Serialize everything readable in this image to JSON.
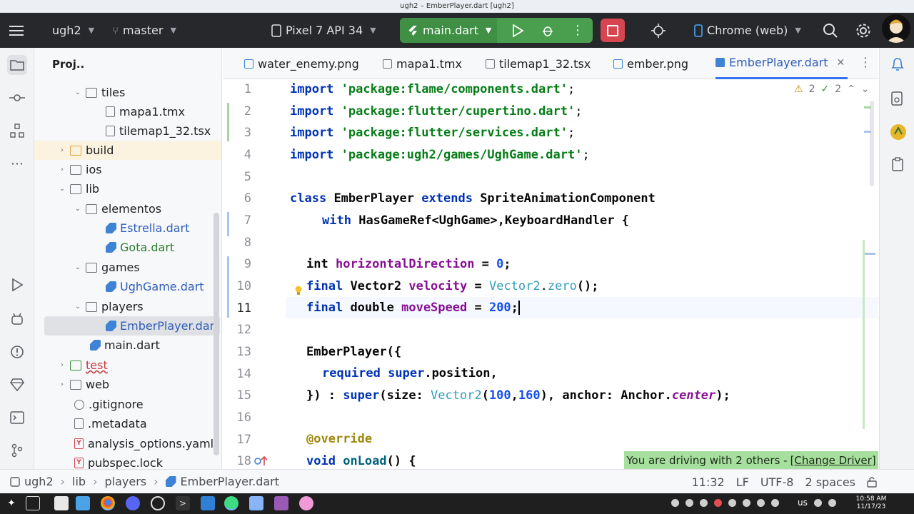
{
  "window_title": "ugh2 – EmberPlayer.dart [ugh2]",
  "toolbar": {
    "project": "ugh2",
    "branch": "master",
    "device": "Pixel 7 API 34",
    "run_config": "main.dart",
    "target": "Chrome (web)"
  },
  "project_panel": {
    "title": "Proj..",
    "items": [
      {
        "label": "tiles",
        "type": "folder"
      },
      {
        "label": "mapa1.tmx",
        "type": "file"
      },
      {
        "label": "tilemap1_32.tsx",
        "type": "file"
      },
      {
        "label": "build",
        "type": "folder"
      },
      {
        "label": "ios",
        "type": "folder"
      },
      {
        "label": "lib",
        "type": "folder"
      },
      {
        "label": "elementos",
        "type": "folder"
      },
      {
        "label": "Estrella.dart",
        "type": "dart"
      },
      {
        "label": "Gota.dart",
        "type": "dart"
      },
      {
        "label": "games",
        "type": "folder"
      },
      {
        "label": "UghGame.dart",
        "type": "dart"
      },
      {
        "label": "players",
        "type": "folder"
      },
      {
        "label": "EmberPlayer.dart",
        "type": "dart"
      },
      {
        "label": "main.dart",
        "type": "dart"
      },
      {
        "label": "test",
        "type": "folder"
      },
      {
        "label": "web",
        "type": "folder"
      },
      {
        "label": ".gitignore",
        "type": "file"
      },
      {
        "label": ".metadata",
        "type": "file"
      },
      {
        "label": "analysis_options.yaml",
        "type": "yaml"
      },
      {
        "label": "pubspec.lock",
        "type": "yaml"
      }
    ]
  },
  "tabs": [
    {
      "label": "water_enemy.png"
    },
    {
      "label": "mapa1.tmx"
    },
    {
      "label": "tilemap1_32.tsx"
    },
    {
      "label": "ember.png"
    },
    {
      "label": "EmberPlayer.dart",
      "active": true
    }
  ],
  "inspections": {
    "warnings": "2",
    "weak_warnings": "2"
  },
  "line_numbers": [
    "1",
    "2",
    "3",
    "4",
    "5",
    "6",
    "7",
    "8",
    "9",
    "10",
    "11",
    "12",
    "13",
    "14",
    "15",
    "16",
    "17",
    "18"
  ],
  "code": {
    "l1_kw": "import",
    "l1_str": "'package:flame/components.dart'",
    "l1_end": ";",
    "l2_kw": "import",
    "l2_str": "'package:flutter/cupertino.dart'",
    "l2_end": ";",
    "l3_kw": "import",
    "l3_str": "'package:flutter/services.dart'",
    "l3_end": ";",
    "l4_kw": "import",
    "l4_str": "'package:ugh2/games/UghGame.dart'",
    "l4_end": ";",
    "l6_kw1": "class",
    "l6_name": "EmberPlayer",
    "l6_kw2": "extends",
    "l6_super": "SpriteAnimationComponent",
    "l7_kw": "with",
    "l7_rest": "HasGameRef<UghGame>,KeyboardHandler {",
    "l9_type": "int",
    "l9_field": "horizontalDirection",
    "l9_eq": " = ",
    "l9_num": "0",
    "l9_end": ";",
    "l10_kw": "final",
    "l10_type": "Vector2",
    "l10_field": "velocity",
    "l10_eq": " = ",
    "l10_cls": "Vector2",
    "l10_dot": ".",
    "l10_fld2": "zero",
    "l10_end": "();",
    "l11_kw": "final",
    "l11_type": "double",
    "l11_field": "moveSpeed",
    "l11_eq": " = ",
    "l11_num": "200",
    "l11_end": ";",
    "l13_text": "EmberPlayer({",
    "l14_kw": "required",
    "l14_kw2": "super",
    "l14_rest": ".position,",
    "l15_a": "}) : ",
    "l15_kw": "super",
    "l15_b": "(size: ",
    "l15_cls": "Vector2",
    "l15_c": "(",
    "l15_n1": "100",
    "l15_comma": ",",
    "l15_n2": "160",
    "l15_d": "), anchor: Anchor.",
    "l15_it": "center",
    "l15_e": ");",
    "l17_ann": "@override",
    "l18_kw": "void",
    "l18_fn": "onLoad",
    "l18_rest": "() {"
  },
  "collab_banner": {
    "text": "You are driving with 2 others -",
    "link": "[Change Driver]"
  },
  "status": {
    "crumbs": [
      "ugh2",
      "lib",
      "players",
      "EmberPlayer.dart"
    ],
    "position": "11:32",
    "line_sep": "LF",
    "encoding": "UTF-8",
    "indent": "2 spaces"
  },
  "taskbar": {
    "lang": "us",
    "time": "10:58 AM",
    "date": "11/17/23"
  }
}
